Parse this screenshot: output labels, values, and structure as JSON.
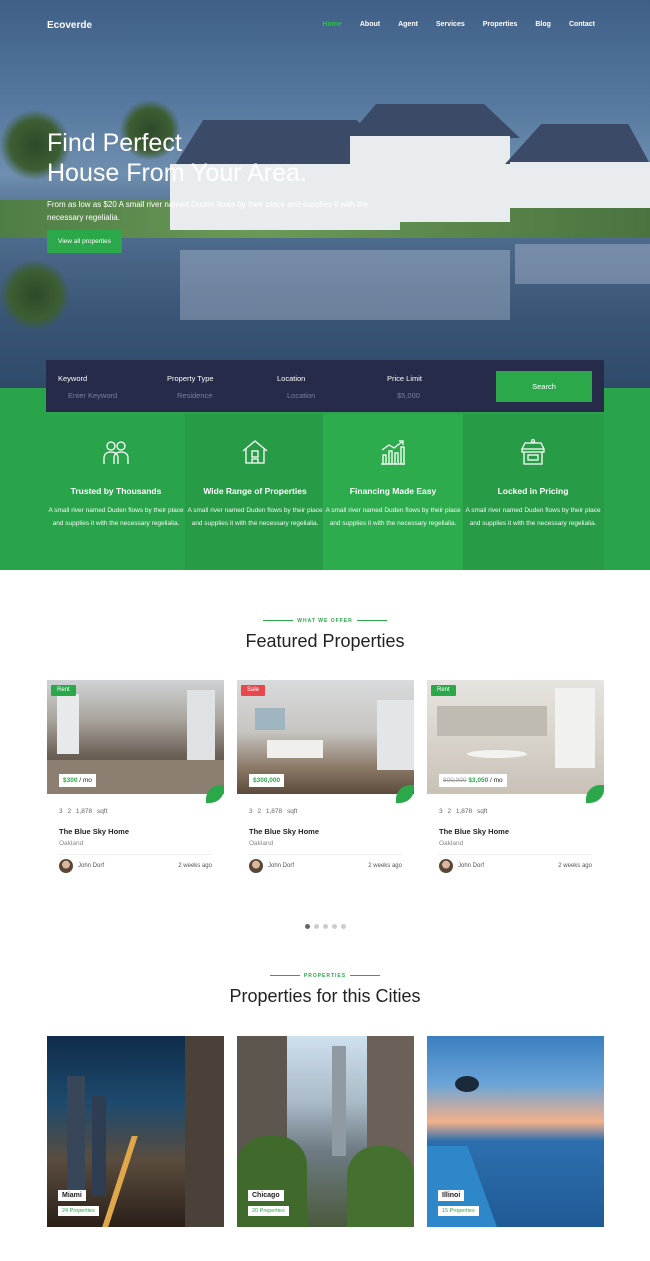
{
  "nav": {
    "logo": "Ecoverde",
    "items": [
      "Home",
      "About",
      "Agent",
      "Services",
      "Properties",
      "Blog",
      "Contact"
    ]
  },
  "hero": {
    "title_line1": "Find Perfect",
    "title_line2": "House From Your Area.",
    "subtitle": "From as low as $20 A small river named Duden flows by their place and supplies it with the necessary regelialia.",
    "button": "View all properties"
  },
  "search": {
    "fields": [
      {
        "label": "Keyword",
        "value": "Enter Keyword"
      },
      {
        "label": "Property Type",
        "value": "Residence"
      },
      {
        "label": "Location",
        "value": "Location"
      },
      {
        "label": "Price Limit",
        "value": "$5,000"
      }
    ],
    "button": "Search"
  },
  "features": [
    {
      "icon": "people-icon",
      "title": "Trusted by Thousands",
      "text": "A small river named Duden flows by their place and supplies it with the necessary regelialia."
    },
    {
      "icon": "house-icon",
      "title": "Wide Range of Properties",
      "text": "A small river named Duden flows by their place and supplies it with the necessary regelialia."
    },
    {
      "icon": "growth-chart-icon",
      "title": "Financing Made Easy",
      "text": "A small river named Duden flows by their place and supplies it with the necessary regelialia."
    },
    {
      "icon": "store-icon",
      "title": "Locked in Pricing",
      "text": "A small river named Duden flows by their place and supplies it with the necessary regelialia."
    }
  ],
  "featured": {
    "eyebrow": "WHAT WE OFFER",
    "heading": "Featured Properties",
    "cards": [
      {
        "tag": "Rent",
        "tag_color": "#2ba84a",
        "old_price": "",
        "price": "$300",
        "price_unit": "/ mo",
        "beds": "3",
        "baths": "2",
        "area": "1,878 sqft",
        "title": "The Blue Sky Home",
        "location": "Oakland",
        "agent": "John Dorf",
        "time": "2 weeks ago"
      },
      {
        "tag": "Sale",
        "tag_color": "#e8474c",
        "old_price": "",
        "price": "$300,000",
        "price_unit": "",
        "beds": "3",
        "baths": "2",
        "area": "1,878 sqft",
        "title": "The Blue Sky Home",
        "location": "Oakland",
        "agent": "John Dorf",
        "time": "2 weeks ago"
      },
      {
        "tag": "Rent",
        "tag_color": "#2ba84a",
        "old_price": "800,000",
        "price": "$3,050",
        "price_unit": "/ mo",
        "beds": "3",
        "baths": "2",
        "area": "1,878 sqft",
        "title": "The Blue Sky Home",
        "location": "Oakland",
        "agent": "John Dorf",
        "time": "2 weeks ago"
      }
    ]
  },
  "cities": {
    "eyebrow": "PROPERTIES",
    "heading": "Properties for this Cities",
    "items": [
      {
        "name": "Miami",
        "count": "24 Properties"
      },
      {
        "name": "Chicago",
        "count": "20 Properties"
      },
      {
        "name": "Illinoi",
        "count": "15 Properties"
      }
    ]
  },
  "colors": {
    "accent": "#2ba84a",
    "search_bg": "#262b49",
    "sale": "#e8474c"
  }
}
